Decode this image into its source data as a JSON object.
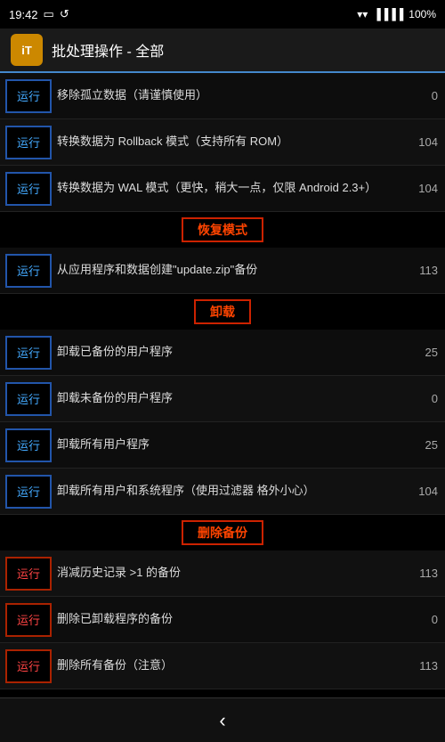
{
  "statusBar": {
    "time": "19:42",
    "battery": "100",
    "wifiIcon": "wifi",
    "signalIcon": "signal"
  },
  "titleBar": {
    "iconLabel": "iT",
    "title": "批处理操作 - 全部"
  },
  "sections": [
    {
      "type": "items",
      "rows": [
        {
          "btnLabel": "运行",
          "desc": "移除孤立数据（请谨慎使用）",
          "count": "0",
          "btnClass": ""
        },
        {
          "btnLabel": "运行",
          "desc": "转换数据为 Rollback 模式（支持所有 ROM）",
          "count": "104",
          "btnClass": ""
        },
        {
          "btnLabel": "运行",
          "desc": "转换数据为 WAL 模式（更快，稍大一点，仅限 Android 2.3+）",
          "count": "104",
          "btnClass": ""
        }
      ]
    },
    {
      "type": "header",
      "label": "恢复模式"
    },
    {
      "type": "items",
      "rows": [
        {
          "btnLabel": "运行",
          "desc": "从应用程序和数据创建\"update.zip\"备份",
          "count": "113",
          "btnClass": ""
        }
      ]
    },
    {
      "type": "header",
      "label": "卸载"
    },
    {
      "type": "items",
      "rows": [
        {
          "btnLabel": "运行",
          "desc": "卸载已备份的用户程序",
          "count": "25",
          "btnClass": ""
        },
        {
          "btnLabel": "运行",
          "desc": "卸载未备份的用户程序",
          "count": "0",
          "btnClass": ""
        },
        {
          "btnLabel": "运行",
          "desc": "卸载所有用户程序",
          "count": "25",
          "btnClass": ""
        },
        {
          "btnLabel": "运行",
          "desc": "卸载所有用户和系统程序（使用过滤器 格外小心）",
          "count": "104",
          "btnClass": ""
        }
      ]
    },
    {
      "type": "header",
      "label": "删除备份"
    },
    {
      "type": "items",
      "rows": [
        {
          "btnLabel": "运行",
          "desc": "消减历史记录 >1 的备份",
          "count": "113",
          "btnClass": "red-border"
        },
        {
          "btnLabel": "运行",
          "desc": "删除已卸载程序的备份",
          "count": "0",
          "btnClass": "red-border"
        },
        {
          "btnLabel": "运行",
          "desc": "删除所有备份（注意）",
          "count": "113",
          "btnClass": "red-border"
        }
      ]
    }
  ],
  "bottomNav": {
    "backLabel": "‹"
  }
}
